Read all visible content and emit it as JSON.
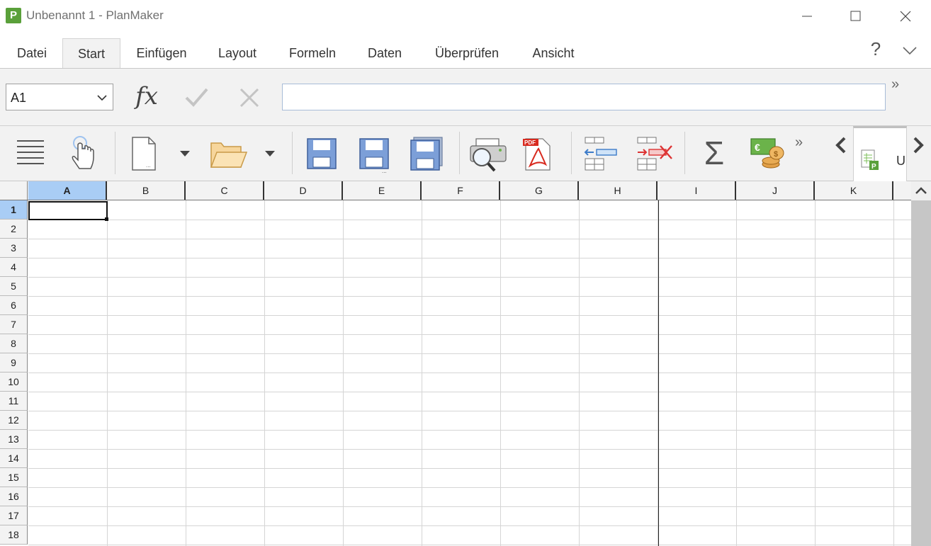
{
  "window": {
    "app_logo_letter": "P",
    "title": "Unbenannt 1 - PlanMaker"
  },
  "menu": {
    "tabs": [
      "Datei",
      "Start",
      "Einfügen",
      "Layout",
      "Formeln",
      "Daten",
      "Überprüfen",
      "Ansicht"
    ],
    "active": "Start",
    "help": "?"
  },
  "formula_bar": {
    "cell_reference": "A1",
    "function_icon": "fx",
    "formula_value": ""
  },
  "toolbar": {
    "icons": [
      "menu-icon",
      "touch-mode-icon",
      "new-document-icon",
      "open-folder-icon",
      "save-icon",
      "save-as-icon",
      "save-all-icon",
      "print-preview-icon",
      "export-pdf-icon",
      "insert-cells-icon",
      "delete-cells-icon",
      "sum-icon",
      "currency-icon"
    ],
    "more": "»",
    "doc_tab_label": "U",
    "sum_symbol": "Σ",
    "pdf_label": "PDF",
    "currency_symbols": [
      "€",
      "$"
    ]
  },
  "sheet": {
    "columns": [
      "A",
      "B",
      "C",
      "D",
      "E",
      "F",
      "G",
      "H",
      "I",
      "J",
      "K"
    ],
    "rows": [
      "1",
      "2",
      "3",
      "4",
      "5",
      "6",
      "7",
      "8",
      "9",
      "10",
      "11",
      "12",
      "13",
      "14",
      "15",
      "16",
      "17",
      "18"
    ],
    "active_cell": "A1",
    "colors": {
      "selected_header": "#a9cdf5",
      "grid": "#d5d5d5"
    }
  }
}
